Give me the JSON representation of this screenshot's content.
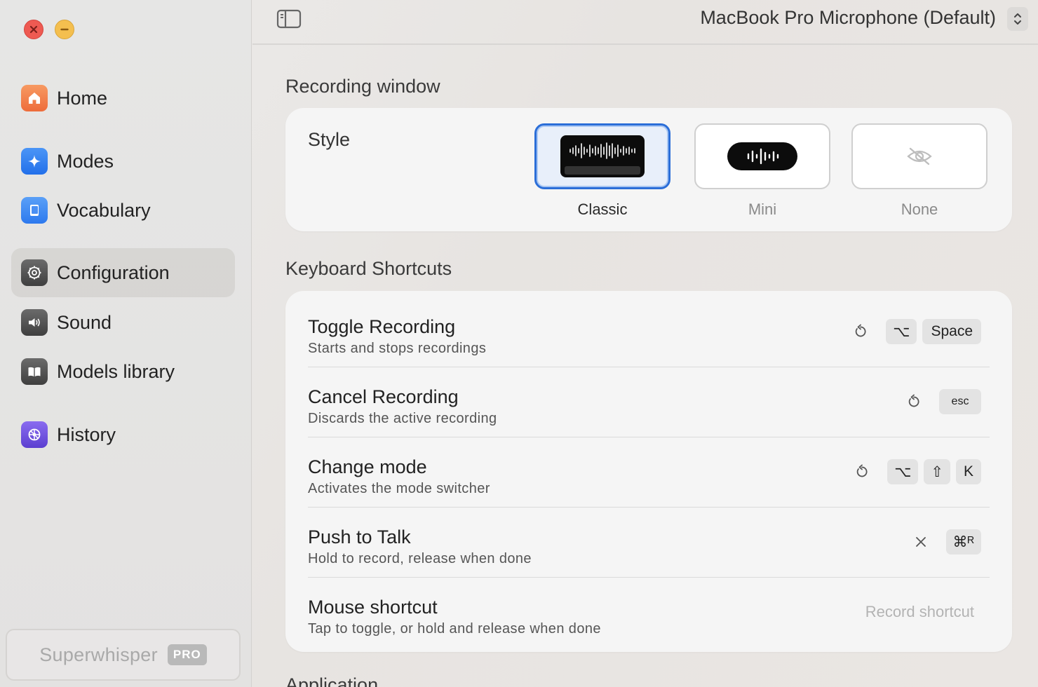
{
  "sidebar": {
    "items": [
      {
        "label": "Home",
        "icon": "house-icon",
        "color": "#f07a45"
      },
      {
        "label": "Modes",
        "icon": "sparkle-icon",
        "color": "#2f7ef0"
      },
      {
        "label": "Vocabulary",
        "icon": "book-icon",
        "color": "#3b86f2"
      },
      {
        "label": "Configuration",
        "icon": "gear-icon",
        "color": "#4a4a4a",
        "active": true
      },
      {
        "label": "Sound",
        "icon": "speaker-icon",
        "color": "#4a4a4a"
      },
      {
        "label": "Models library",
        "icon": "open-book-icon",
        "color": "#4a4a4a"
      },
      {
        "label": "History",
        "icon": "history-icon",
        "color": "#6d4fd8"
      }
    ],
    "app_name": "Superwhisper",
    "badge": "PRO"
  },
  "header": {
    "microphone": "MacBook Pro Microphone (Default)"
  },
  "recording_window": {
    "title": "Recording window",
    "style_label": "Style",
    "options": [
      "Classic",
      "Mini",
      "None"
    ],
    "selected": "Classic"
  },
  "shortcuts": {
    "title": "Keyboard Shortcuts",
    "rows": [
      {
        "title": "Toggle Recording",
        "subtitle": "Starts and stops recordings",
        "keys": [
          "⌥",
          "Space"
        ]
      },
      {
        "title": "Cancel Recording",
        "subtitle": "Discards the active recording",
        "keys": [
          "esc"
        ]
      },
      {
        "title": "Change mode",
        "subtitle": "Activates the mode switcher",
        "keys": [
          "⌥",
          "⇧",
          "K"
        ]
      },
      {
        "title": "Push to Talk",
        "subtitle": "Hold to record, release when done",
        "keys": [
          "⌘ᴿ"
        ]
      },
      {
        "title": "Mouse shortcut",
        "subtitle": "Tap to toggle, or hold and release when done",
        "action": "Record shortcut"
      }
    ]
  },
  "next_section": {
    "title": "Application"
  }
}
